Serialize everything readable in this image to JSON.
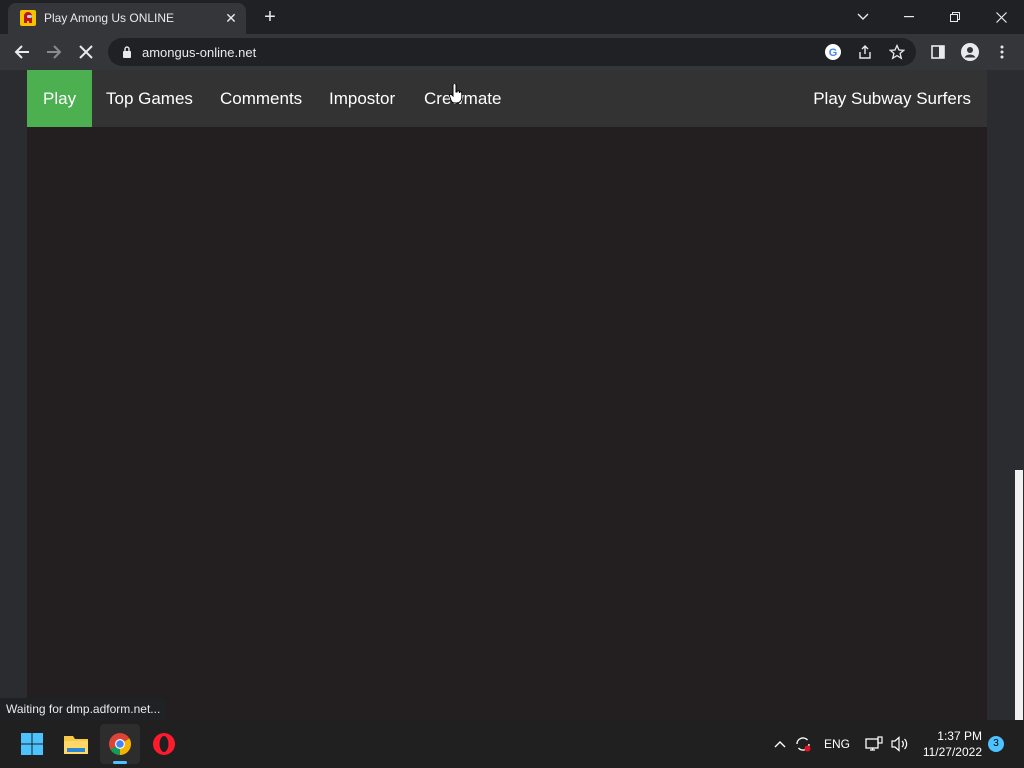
{
  "browser": {
    "tab_title": "Play Among Us ONLINE",
    "url": "amongus-online.net",
    "status_text": "Waiting for dmp.adform.net..."
  },
  "site_nav": {
    "items": [
      "Play",
      "Top Games",
      "Comments",
      "Impostor",
      "Crewmate"
    ],
    "right_link": "Play Subway Surfers",
    "active_color": "#4caf50"
  },
  "taskbar": {
    "language": "ENG",
    "time": "1:37 PM",
    "date": "11/27/2022",
    "notification_count": "3"
  }
}
